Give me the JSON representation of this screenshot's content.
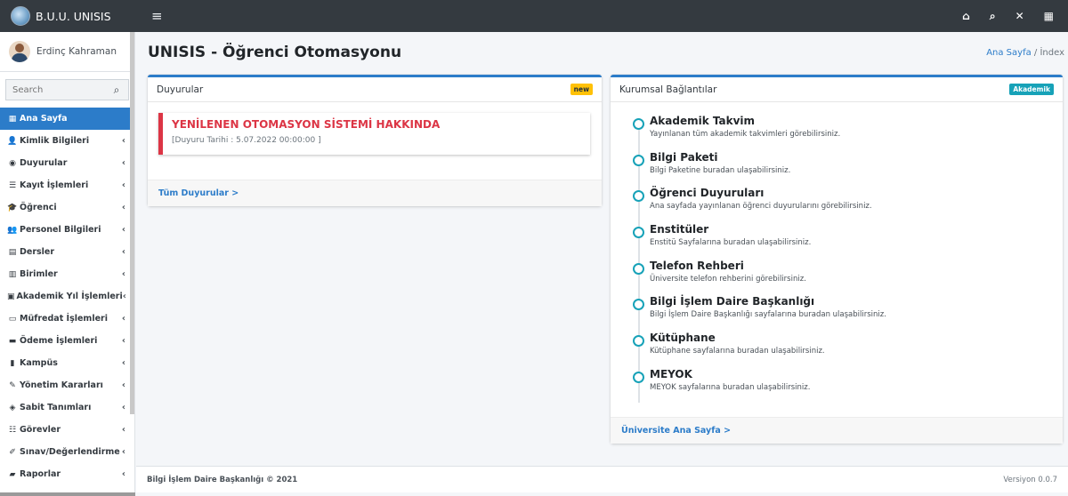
{
  "brand": {
    "name": "B.U.U. UNISIS"
  },
  "topbar": {
    "icons": [
      "building-icon",
      "search-icon",
      "expand-icon",
      "grid-icon"
    ]
  },
  "user": {
    "name": "Erdinç Kahraman"
  },
  "search": {
    "placeholder": "Search"
  },
  "sidebar": {
    "items": [
      {
        "label": "Ana Sayfa",
        "icon": "▦",
        "active": true,
        "arrow": ""
      },
      {
        "label": "Kimlik Bilgileri",
        "icon": "👤",
        "arrow": "‹"
      },
      {
        "label": "Duyurular",
        "icon": "◉",
        "arrow": "‹"
      },
      {
        "label": "Kayıt İşlemleri",
        "icon": "☰",
        "arrow": "‹"
      },
      {
        "label": "Öğrenci",
        "icon": "🎓",
        "arrow": "‹"
      },
      {
        "label": "Personel Bilgileri",
        "icon": "👥",
        "arrow": "‹"
      },
      {
        "label": "Dersler",
        "icon": "▤",
        "arrow": "‹"
      },
      {
        "label": "Birimler",
        "icon": "▥",
        "arrow": "‹"
      },
      {
        "label": "Akademik Yıl İşlemleri",
        "icon": "▣",
        "arrow": "‹"
      },
      {
        "label": "Müfredat İşlemleri",
        "icon": "▭",
        "arrow": "‹"
      },
      {
        "label": "Ödeme İşlemleri",
        "icon": "▬",
        "arrow": "‹"
      },
      {
        "label": "Kampüs",
        "icon": "▮",
        "arrow": "‹"
      },
      {
        "label": "Yönetim Kararları",
        "icon": "✎",
        "arrow": "‹"
      },
      {
        "label": "Sabit Tanımları",
        "icon": "◈",
        "arrow": "‹"
      },
      {
        "label": "Görevler",
        "icon": "☷",
        "arrow": "‹"
      },
      {
        "label": "Sınav/Değerlendirme",
        "icon": "✐",
        "arrow": "‹"
      },
      {
        "label": "Raporlar",
        "icon": "▰",
        "arrow": "‹"
      }
    ]
  },
  "header": {
    "title": "UNISIS - Öğrenci Otomasyonu",
    "breadcrumb": {
      "home": "Ana Sayfa",
      "sep": "/",
      "current": "İndex"
    }
  },
  "announcements": {
    "title": "Duyurular",
    "badge": "new",
    "item": {
      "title": "YENİLENEN OTOMASYON SİSTEMİ HAKKINDA",
      "date": "[Duyuru Tarihi : 5.07.2022 00:00:00 ]"
    },
    "footer_link": "Tüm Duyurular >"
  },
  "links": {
    "title": "Kurumsal Bağlantılar",
    "badge": "Akademik",
    "items": [
      {
        "title": "Akademik Takvim",
        "desc": "Yayınlanan tüm akademik takvimleri görebilirsiniz."
      },
      {
        "title": "Bilgi Paketi",
        "desc": "Bilgi Paketine buradan ulaşabilirsiniz."
      },
      {
        "title": "Öğrenci Duyuruları",
        "desc": "Ana sayfada yayınlanan öğrenci duyurularını görebilirsiniz."
      },
      {
        "title": "Enstitüler",
        "desc": "Enstitü Sayfalarına buradan ulaşabilirsiniz."
      },
      {
        "title": "Telefon Rehberi",
        "desc": "Üniversite telefon rehberini görebilirsiniz."
      },
      {
        "title": "Bilgi İşlem Daire Başkanlığı",
        "desc": "Bilgi İşlem Daire Başkanlığı sayfalarına buradan ulaşabilirsiniz."
      },
      {
        "title": "Kütüphane",
        "desc": "Kütüphane sayfalarına buradan ulaşabilirsiniz."
      },
      {
        "title": "MEYOK",
        "desc": "MEYOK sayfalarına buradan ulaşabilirsiniz."
      }
    ],
    "footer_link": "Üniversite Ana Sayfa >"
  },
  "footer": {
    "left": "Bilgi İşlem Daire Başkanlığı © 2021",
    "right": "Versiyon 0.0.7"
  },
  "colors": {
    "primary": "#2c7cc9",
    "navbar": "#343a40",
    "danger": "#dc3545",
    "info": "#17a2b8",
    "warning": "#ffc107"
  }
}
